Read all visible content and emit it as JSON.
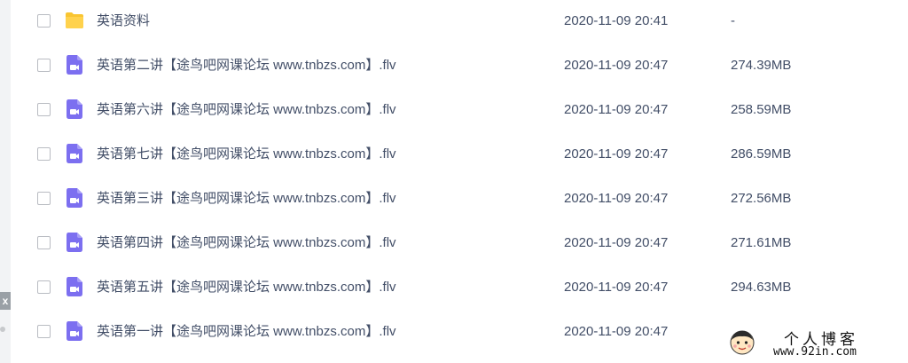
{
  "file_list": {
    "rows": [
      {
        "icon": "folder-icon",
        "name": "英语资料",
        "modified": "2020-11-09 20:41",
        "size": "-"
      },
      {
        "icon": "video-file-icon",
        "name": "英语第二讲【途鸟吧网课论坛 www.tnbzs.com】.flv",
        "modified": "2020-11-09 20:47",
        "size": "274.39MB"
      },
      {
        "icon": "video-file-icon",
        "name": "英语第六讲【途鸟吧网课论坛 www.tnbzs.com】.flv",
        "modified": "2020-11-09 20:47",
        "size": "258.59MB"
      },
      {
        "icon": "video-file-icon",
        "name": "英语第七讲【途鸟吧网课论坛 www.tnbzs.com】.flv",
        "modified": "2020-11-09 20:47",
        "size": "286.59MB"
      },
      {
        "icon": "video-file-icon",
        "name": "英语第三讲【途鸟吧网课论坛 www.tnbzs.com】.flv",
        "modified": "2020-11-09 20:47",
        "size": "272.56MB"
      },
      {
        "icon": "video-file-icon",
        "name": "英语第四讲【途鸟吧网课论坛 www.tnbzs.com】.flv",
        "modified": "2020-11-09 20:47",
        "size": "271.61MB"
      },
      {
        "icon": "video-file-icon",
        "name": "英语第五讲【途鸟吧网课论坛 www.tnbzs.com】.flv",
        "modified": "2020-11-09 20:47",
        "size": "294.63MB"
      },
      {
        "icon": "video-file-icon",
        "name": "英语第一讲【途鸟吧网课论坛 www.tnbzs.com】.flv",
        "modified": "2020-11-09 20:47",
        "size": ""
      }
    ]
  },
  "side_float": {
    "close_label": "x"
  },
  "watermark": {
    "title": "个人博客",
    "url": "www.92in.com"
  },
  "colors": {
    "folder": "#f9c531",
    "video_icon": "#7c6ff0",
    "text": "#424e67",
    "checkbox_border": "#b9bcc2"
  }
}
